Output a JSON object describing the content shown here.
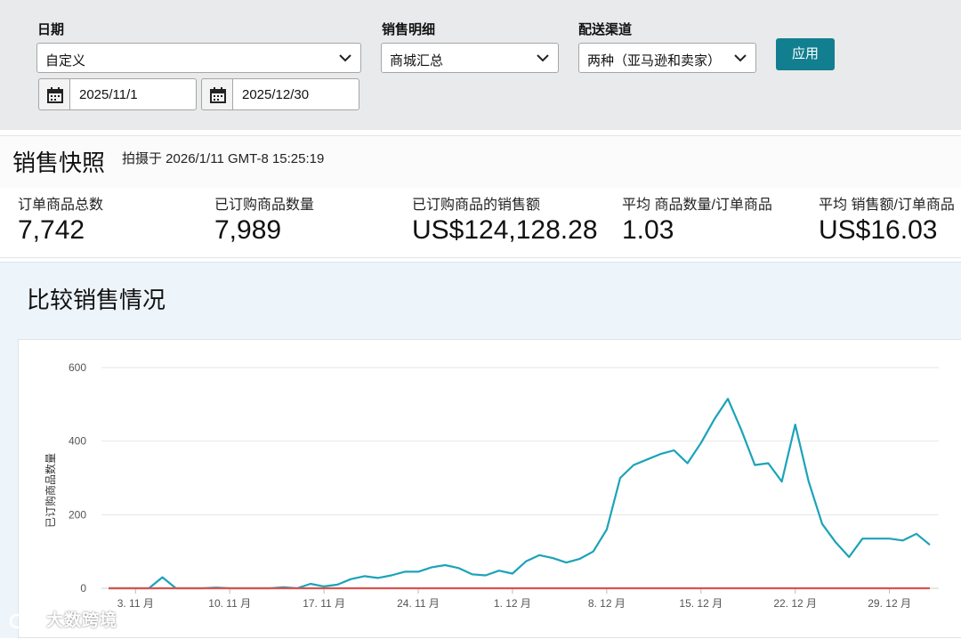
{
  "filters": {
    "date_label": "日期",
    "date_select": "自定义",
    "start_date": "2025/11/1",
    "end_date": "2025/12/30",
    "detail_label": "销售明细",
    "detail_select": "商城汇总",
    "channel_label": "配送渠道",
    "channel_select": "两种（亚马逊和卖家）",
    "apply_label": "应用",
    "accent_color": "#117f8f"
  },
  "snapshot": {
    "title": "销售快照",
    "timestamp": "拍摄于 2026/1/11 GMT-8 15:25:19",
    "metrics": [
      {
        "label": "订单商品总数",
        "value": "7,742"
      },
      {
        "label": "已订购商品数量",
        "value": "7,989"
      },
      {
        "label": "已订购商品的销售额",
        "value": "US$124,128.28"
      },
      {
        "label": "平均 商品数量/订单商品",
        "value": "1.03"
      },
      {
        "label": "平均 销售额/订单商品",
        "value": "US$16.03"
      }
    ]
  },
  "compare": {
    "title": "比较销售情况"
  },
  "chart_data": {
    "type": "line",
    "ylabel": "已订购商品数量",
    "ylim": [
      0,
      600
    ],
    "yticks": [
      "0",
      "200",
      "400",
      "600"
    ],
    "xticks": [
      {
        "day": 3,
        "label": "3. 11 月"
      },
      {
        "day": 10,
        "label": "10. 11 月"
      },
      {
        "day": 17,
        "label": "17. 11 月"
      },
      {
        "day": 24,
        "label": "24. 11 月"
      },
      {
        "day": 31,
        "label": "1. 12 月"
      },
      {
        "day": 38,
        "label": "8. 12 月"
      },
      {
        "day": 45,
        "label": "15. 12 月"
      },
      {
        "day": 52,
        "label": "22. 12 月"
      },
      {
        "day": 59,
        "label": "29. 12 月"
      }
    ],
    "grid": true,
    "series": [
      {
        "color": "#1ba3b8",
        "values": [
          0,
          0,
          0,
          0,
          30,
          0,
          0,
          0,
          2,
          0,
          0,
          0,
          0,
          3,
          0,
          12,
          5,
          10,
          25,
          33,
          28,
          35,
          45,
          45,
          57,
          63,
          55,
          38,
          35,
          48,
          40,
          73,
          90,
          82,
          70,
          80,
          100,
          160,
          300,
          335,
          350,
          365,
          375,
          340,
          395,
          460,
          515,
          430,
          335,
          340,
          290,
          445,
          290,
          175,
          125,
          85,
          135,
          135,
          135,
          130,
          148,
          118
        ],
        "start_label": "11/1"
      },
      {
        "color": "#d9534f",
        "values": [
          0,
          0,
          0,
          0,
          0,
          0,
          0,
          0,
          0,
          0,
          0,
          0,
          0,
          0,
          0,
          0,
          0,
          0,
          0,
          0,
          0,
          0,
          0,
          0,
          0,
          0,
          0,
          0,
          0,
          0,
          0,
          0,
          0,
          0,
          0,
          0,
          0,
          0,
          0,
          0,
          0,
          0,
          0,
          0,
          0,
          0,
          0,
          0,
          0,
          0,
          0,
          0,
          0,
          0,
          0,
          0,
          0,
          0,
          0,
          0,
          0,
          0
        ]
      }
    ]
  },
  "watermark": {
    "text": "大数跨境"
  }
}
